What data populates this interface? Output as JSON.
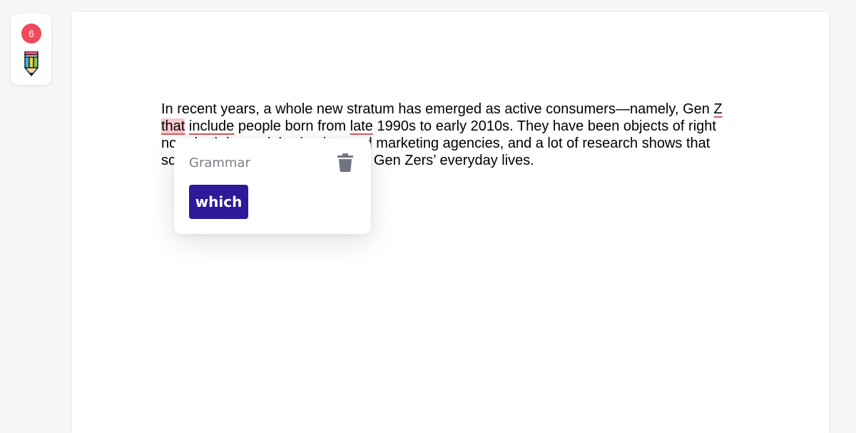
{
  "widget": {
    "issue_count": "6",
    "icon": "pencil-icon"
  },
  "document": {
    "seg1": "In recent years, a whole new stratum has emerged as active consumers—namely, Gen ",
    "err1": "Z",
    "sp1": " ",
    "err2": "that",
    "sp2": " ",
    "err3": "include",
    "seg2": " people born from ",
    "err4": "late",
    "seg3": " 1990s to early 2010s. They have been objects of right now, both by social scientists and marketing agencies, and a lot of research shows that social media is an integral part of Gen Zers’ everyday lives."
  },
  "popup": {
    "category": "Grammar",
    "suggestion": "which",
    "delete_icon": "trash-icon"
  },
  "colors": {
    "accent": "#2c1a9b",
    "badge": "#ee4a5c",
    "error_underline": "#e2545d",
    "error_highlight": "#f7c8cc"
  }
}
